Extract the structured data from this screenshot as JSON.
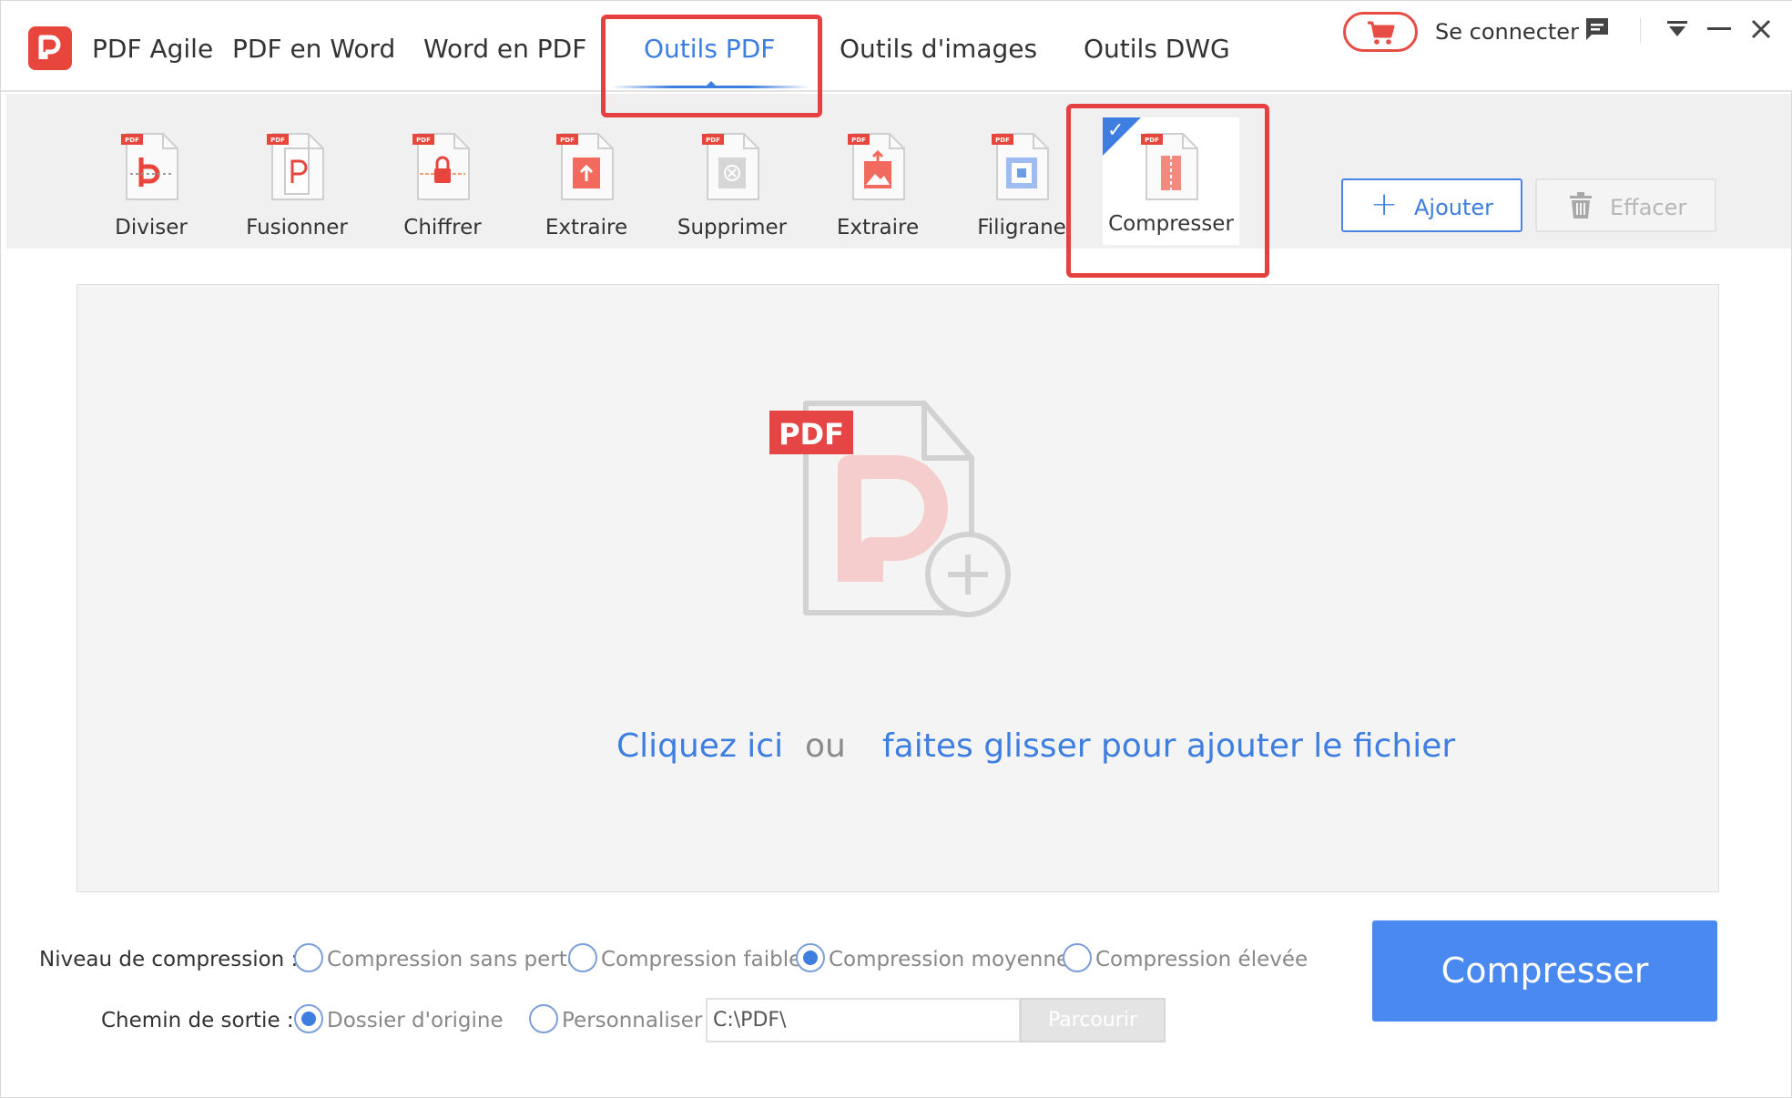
{
  "app": {
    "name": "PDF Agile",
    "nav_tabs": [
      {
        "label": "PDF en Word"
      },
      {
        "label": "Word en PDF"
      },
      {
        "label": "Outils PDF",
        "active": true
      },
      {
        "label": "Outils d'images"
      },
      {
        "label": "Outils DWG"
      }
    ],
    "login_label": "Se connecter"
  },
  "tools": [
    {
      "label": "Diviser",
      "icon": "split-pdf-icon"
    },
    {
      "label": "Fusionner",
      "icon": "merge-pdf-icon"
    },
    {
      "label": "Chiffrer",
      "icon": "encrypt-pdf-icon"
    },
    {
      "label": "Extraire",
      "icon": "extract-pages-icon"
    },
    {
      "label": "Supprimer",
      "icon": "delete-pages-icon"
    },
    {
      "label": "Extraire",
      "icon": "extract-images-icon"
    },
    {
      "label": "Filigrane",
      "icon": "watermark-icon"
    },
    {
      "label": "Compresser",
      "icon": "compress-pdf-icon",
      "selected": true
    }
  ],
  "actions": {
    "add_label": "Ajouter",
    "clear_label": "Effacer"
  },
  "dropzone": {
    "badge": "PDF",
    "click_text": "Cliquez ici",
    "or_text": "ou",
    "drag_text": "faites glisser pour ajouter le fichier"
  },
  "compression": {
    "label": "Niveau de compression :",
    "options": [
      {
        "label": "Compression sans perte",
        "selected": false
      },
      {
        "label": "Compression faible",
        "selected": false
      },
      {
        "label": "Compression moyenne",
        "selected": true
      },
      {
        "label": "Compression élevée",
        "selected": false
      }
    ]
  },
  "output": {
    "label": "Chemin de sortie :",
    "options": [
      {
        "label": "Dossier d'origine",
        "selected": true
      },
      {
        "label": "Personnaliser",
        "selected": false
      }
    ],
    "path_value": "C:\\PDF\\",
    "browse_label": "Parcourir"
  },
  "compress_button_label": "Compresser",
  "colors": {
    "accent": "#3d7ee0",
    "brand_red": "#e8453c",
    "highlight": "#e64040",
    "primary_button": "#4a89f0"
  }
}
